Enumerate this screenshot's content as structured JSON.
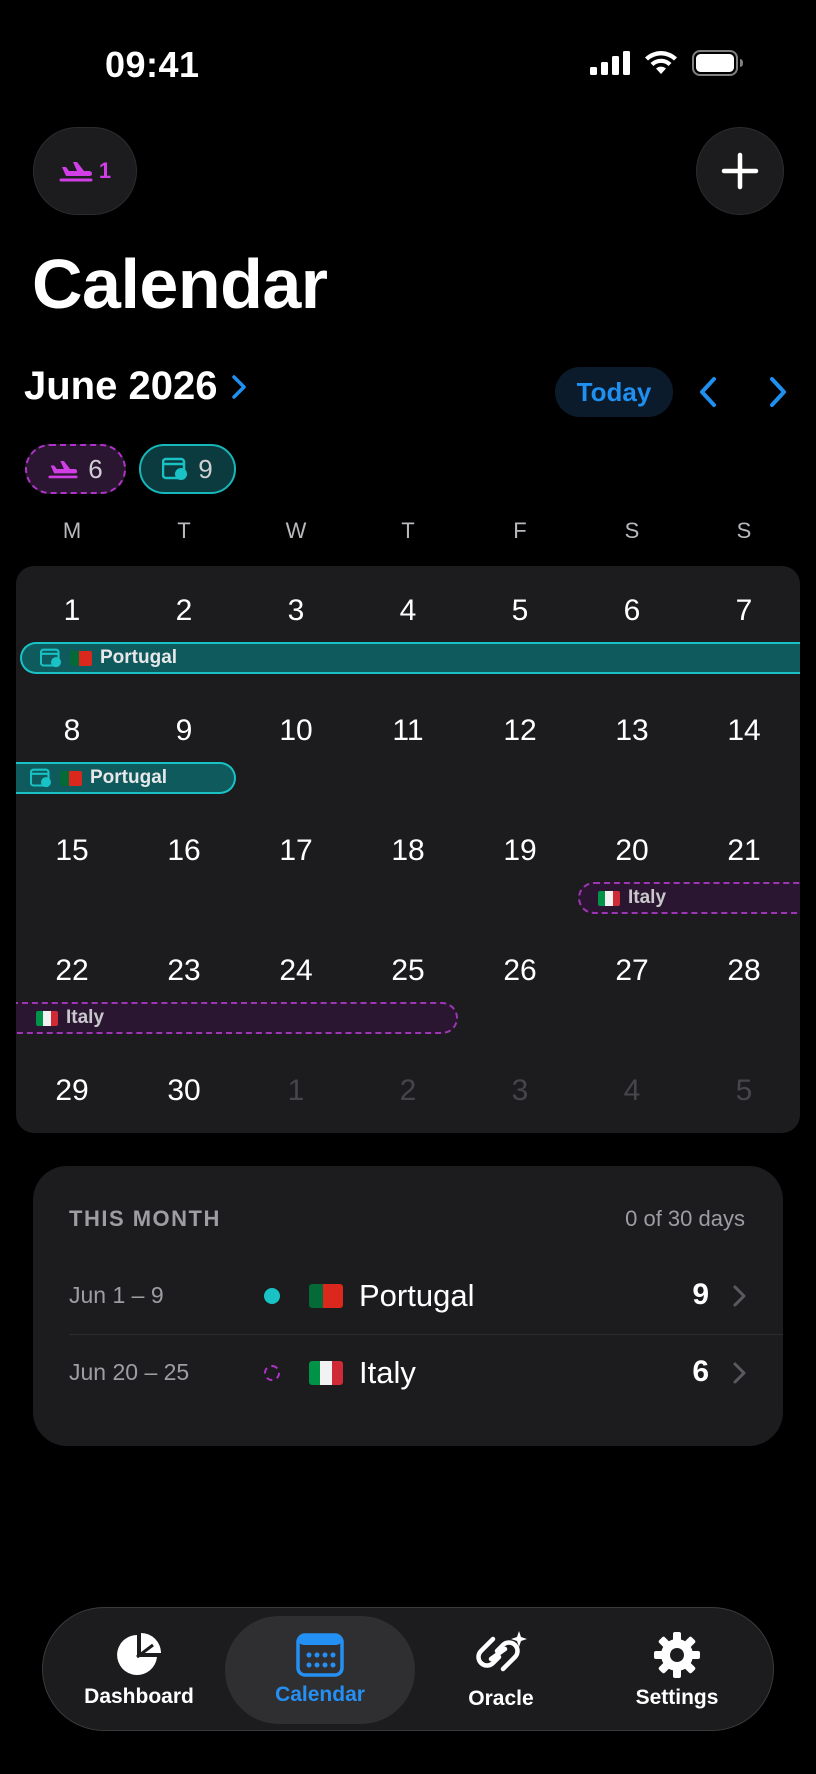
{
  "status_bar": {
    "time": "09:41"
  },
  "header": {
    "trips_count": "1",
    "title": "Calendar"
  },
  "month_nav": {
    "month_label": "June 2026",
    "today_label": "Today"
  },
  "filters": {
    "planned_count": "6",
    "confirmed_count": "9"
  },
  "weekdays": [
    "M",
    "T",
    "W",
    "T",
    "F",
    "S",
    "S"
  ],
  "calendar": {
    "days": [
      "1",
      "2",
      "3",
      "4",
      "5",
      "6",
      "7",
      "8",
      "9",
      "10",
      "11",
      "12",
      "13",
      "14",
      "15",
      "16",
      "17",
      "18",
      "19",
      "20",
      "21",
      "22",
      "23",
      "24",
      "25",
      "26",
      "27",
      "28",
      "29",
      "30",
      "1",
      "2",
      "3",
      "4",
      "5"
    ],
    "trip_bars": [
      {
        "label": "Portugal",
        "status": "confirmed"
      },
      {
        "label": "Portugal",
        "status": "confirmed"
      },
      {
        "label": "Italy",
        "status": "planned"
      },
      {
        "label": "Italy",
        "status": "planned"
      }
    ]
  },
  "summary": {
    "heading": "THIS MONTH",
    "days_label": "0 of 30 days",
    "trips": [
      {
        "dates": "Jun 1 – 9",
        "country": "Portugal",
        "days": "9",
        "status": "confirmed"
      },
      {
        "dates": "Jun 20 – 25",
        "country": "Italy",
        "days": "6",
        "status": "planned"
      }
    ]
  },
  "colors": {
    "accent_blue": "#1f8ff0",
    "confirmed_teal": "#19c2c5",
    "planned_purple": "#b033c9"
  },
  "tabbar": {
    "tabs": [
      {
        "label": "Dashboard",
        "icon": "pie-chart-icon"
      },
      {
        "label": "Calendar",
        "icon": "calendar-icon"
      },
      {
        "label": "Oracle",
        "icon": "oracle-icon"
      },
      {
        "label": "Settings",
        "icon": "gear-icon"
      }
    ]
  }
}
